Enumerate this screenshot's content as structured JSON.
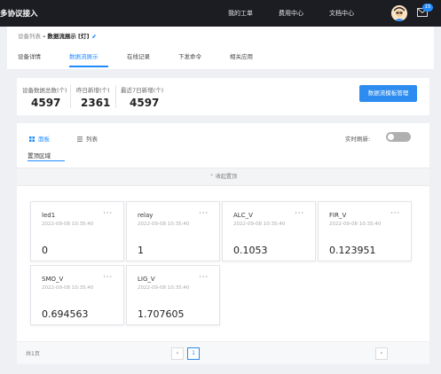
{
  "topbar": {
    "app_title": "多协议接入",
    "nav": [
      "我的工单",
      "费用中心",
      "文档中心"
    ],
    "badge": "15",
    "bg_color": "#1b1d23"
  },
  "breadcrumb": {
    "parent": "设备列表",
    "separator": "–",
    "current": "数据流展示",
    "tag": "[灯]"
  },
  "tabs": [
    "设备详情",
    "数据流展示",
    "在线记录",
    "下发命令",
    "相关应用"
  ],
  "active_tab": "数据流展示",
  "stats": [
    {
      "label": "设备数据总数(个)",
      "value": "4597"
    },
    {
      "label": "昨日新增(个)",
      "value": "2361"
    },
    {
      "label": "最近7日新增(个)",
      "value": "4597"
    }
  ],
  "template_button": "数据流模板管理",
  "view_tabs": {
    "board": "面板",
    "list": "列表"
  },
  "realtime_label": "实时刷新:",
  "pin_area_label": "置顶区域",
  "collapse_label": "⌃ 收起置顶",
  "cards": [
    {
      "name": "led1",
      "time": "2022-09-08 10:35:40",
      "value": "0"
    },
    {
      "name": "relay",
      "time": "2022-09-08 10:35:40",
      "value": "1"
    },
    {
      "name": "ALC_V",
      "time": "2022-09-08 10:35:40",
      "value": "0.1053"
    },
    {
      "name": "FIR_V",
      "time": "2022-09-08 10:35:40",
      "value": "0.123951"
    },
    {
      "name": "SMO_V",
      "time": "2022-09-08 10:35:40",
      "value": "0.694563"
    },
    {
      "name": "LIG_V",
      "time": "2022-09-08 10:35:40",
      "value": "1.707605"
    }
  ],
  "card_menu": "···",
  "pagination": {
    "total": "共1页",
    "prev": "‹",
    "page": "1",
    "next": "›"
  },
  "accent_color": "#2d8cf0"
}
